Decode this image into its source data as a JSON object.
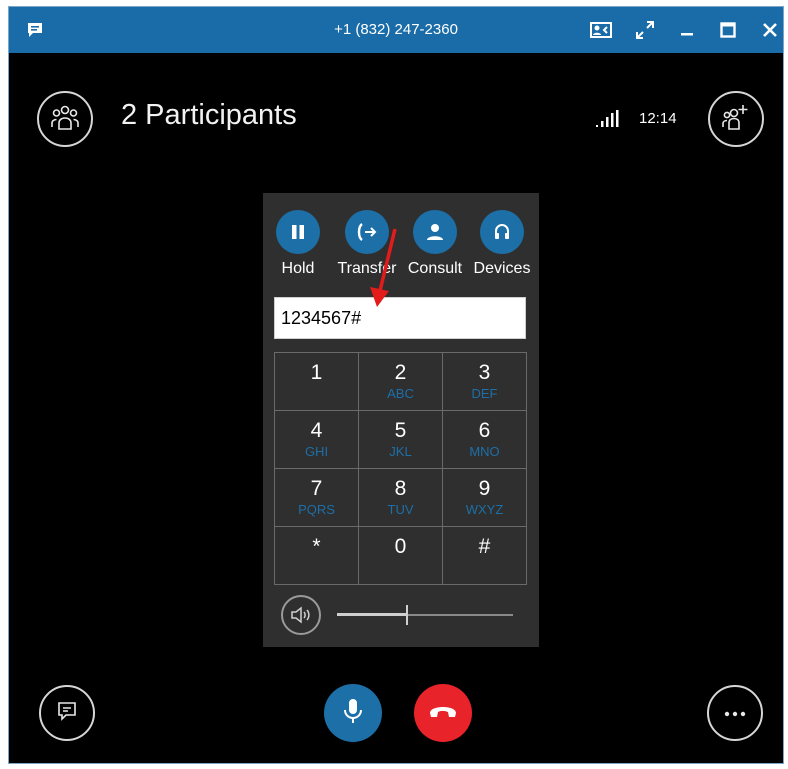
{
  "window": {
    "title": "+1 (832) 247-2360",
    "icons": [
      "chat-icon",
      "contact-card-icon",
      "popout-icon",
      "minimize-icon",
      "maximize-icon",
      "close-icon"
    ]
  },
  "header": {
    "participants_label": "2 Participants",
    "time": "12:14",
    "icons": [
      "participants-icon",
      "signal-icon",
      "add-participant-icon"
    ]
  },
  "call_controls": [
    {
      "label": "Hold",
      "icon": "pause-icon"
    },
    {
      "label": "Transfer",
      "icon": "transfer-icon"
    },
    {
      "label": "Consult",
      "icon": "person-icon"
    },
    {
      "label": "Devices",
      "icon": "headset-icon"
    }
  ],
  "dialpad": {
    "input_value": "1234567#",
    "keys": [
      {
        "digit": "1",
        "letters": ""
      },
      {
        "digit": "2",
        "letters": "ABC"
      },
      {
        "digit": "3",
        "letters": "DEF"
      },
      {
        "digit": "4",
        "letters": "GHI"
      },
      {
        "digit": "5",
        "letters": "JKL"
      },
      {
        "digit": "6",
        "letters": "MNO"
      },
      {
        "digit": "7",
        "letters": "PQRS"
      },
      {
        "digit": "8",
        "letters": "TUV"
      },
      {
        "digit": "9",
        "letters": "WXYZ"
      },
      {
        "digit": "*",
        "letters": ""
      },
      {
        "digit": "0",
        "letters": ""
      },
      {
        "digit": "#",
        "letters": ""
      }
    ],
    "volume_level": 0.4,
    "volume_icon": "speaker-icon"
  },
  "footer": {
    "icons": [
      "im-icon",
      "microphone-icon",
      "hang-up-icon",
      "more-options-icon"
    ]
  },
  "annotation": {
    "icon": "red-arrow-icon"
  },
  "colors": {
    "titlebar": "#1a6ca8",
    "accent": "#1d6fa8",
    "hangup": "#e8232a",
    "background": "#000000",
    "panel": "#2f2f2f"
  }
}
